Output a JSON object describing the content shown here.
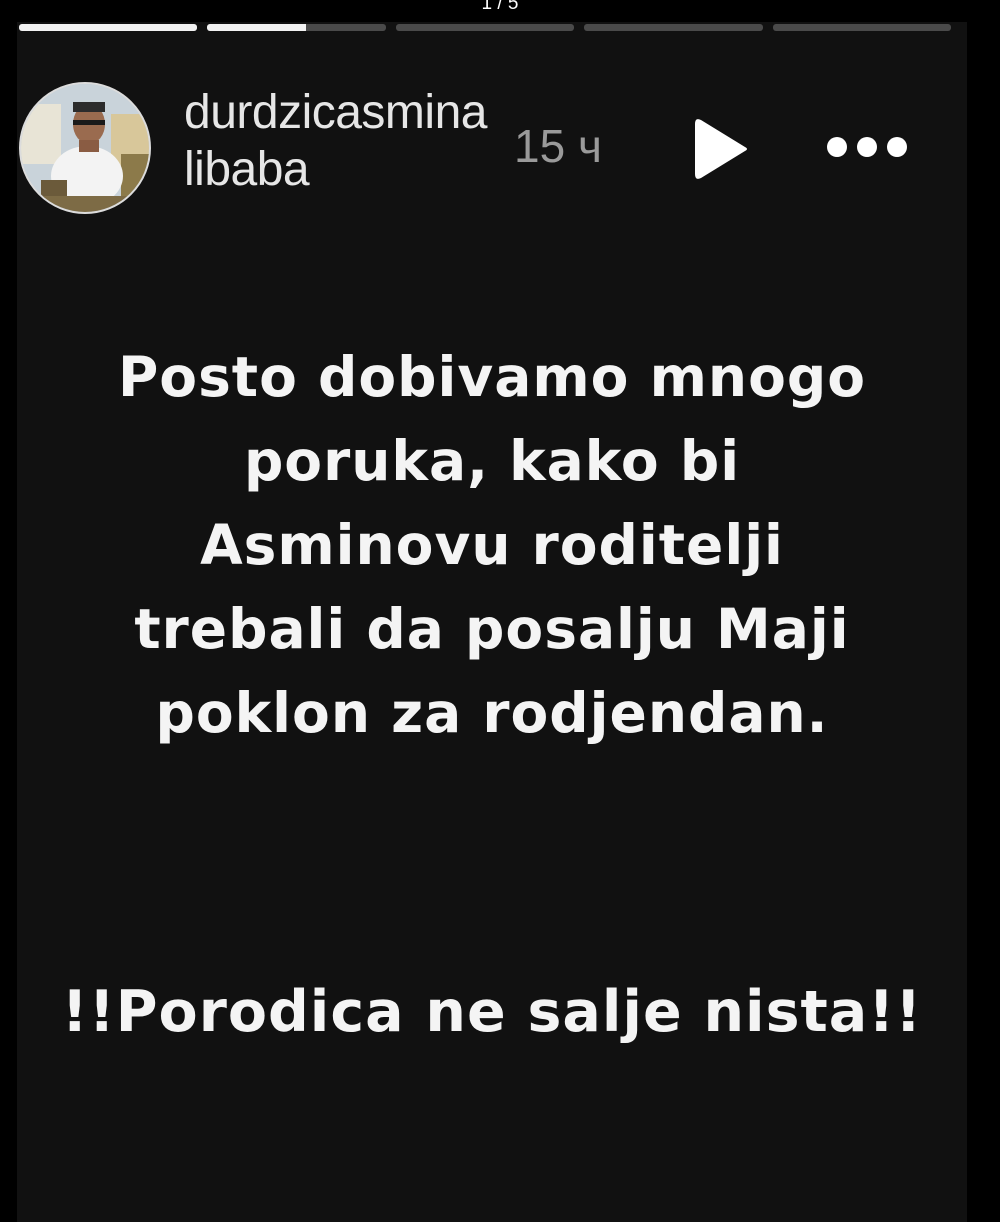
{
  "viewer": {
    "counter": "1 / 5"
  },
  "progress": {
    "segment_count": 5,
    "fills": [
      1,
      0.55,
      0,
      0,
      0
    ]
  },
  "header": {
    "username": "durdzicasminalibaba",
    "time": "15 ч",
    "play_icon": "play-icon",
    "more_icon": "more-options-icon"
  },
  "story": {
    "lines": [
      "Posto dobivamo mnogo",
      "poruka, kako bi",
      "Asminovu roditelji",
      "trebali da posalju Maji",
      "poklon za rodjendan."
    ],
    "notice": "!!Porodica ne salje nista!!"
  },
  "colors": {
    "background": "#000000",
    "card": "#111111",
    "text": "#f4f4f4",
    "muted": "#9a9a9a",
    "progress_track": "#4a4a4a",
    "progress_fill": "#f2f2f2"
  }
}
